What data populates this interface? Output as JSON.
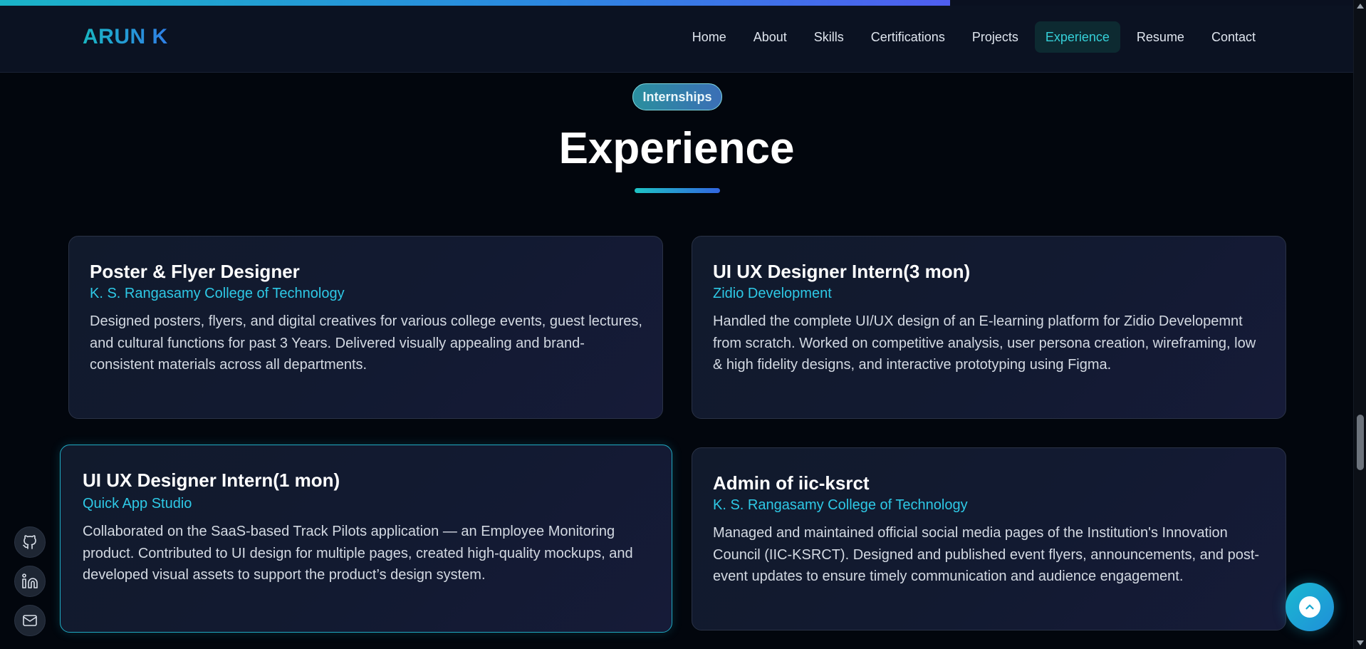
{
  "progress": {
    "fraction": 0.702
  },
  "brand": {
    "name": "ARUN K"
  },
  "nav": {
    "items": [
      {
        "label": "Home"
      },
      {
        "label": "About"
      },
      {
        "label": "Skills"
      },
      {
        "label": "Certifications"
      },
      {
        "label": "Projects"
      },
      {
        "label": "Experience",
        "active": true
      },
      {
        "label": "Resume"
      },
      {
        "label": "Contact"
      }
    ]
  },
  "section": {
    "badge": "Internships",
    "title": "Experience"
  },
  "cards": [
    {
      "title": "Poster & Flyer Designer",
      "org": "K. S. Rangasamy College of Technology",
      "desc": "Designed posters, flyers, and digital creatives for various college events, guest lectures, and cultural functions for past 3 Years. Delivered visually appealing and brand-consistent materials across all departments."
    },
    {
      "title": "UI UX Designer Intern(3 mon)",
      "org": "Zidio Development",
      "desc": "Handled the complete UI/UX design of an E-learning platform for Zidio Developemnt from scratch. Worked on competitive analysis, user persona creation, wireframing, low & high fidelity designs, and interactive prototyping using Figma."
    },
    {
      "title": "UI UX Designer Intern(1 mon)",
      "org": "Quick App Studio",
      "desc": "Collaborated on the SaaS-based Track Pilots application — an Employee Monitoring product. Contributed to UI design for multiple pages, created high-quality mockups, and developed visual assets to support the product’s design system."
    },
    {
      "title": "Admin of iic-ksrct",
      "org": "K. S. Rangasamy College of Technology",
      "desc": "Managed and maintained official social media pages of the Institution's Innovation Council (IIC-KSRCT). Designed and published event flyers, announcements, and post-event updates to ensure timely communication and audience engagement."
    }
  ],
  "social": [
    {
      "icon": "github-icon"
    },
    {
      "icon": "linkedin-icon"
    },
    {
      "icon": "mail-icon"
    }
  ],
  "colors": {
    "accent": "#2ec9e6",
    "background": "#02060d",
    "navbar": "#0b1222",
    "active_nav_text": "#35d0d8"
  }
}
